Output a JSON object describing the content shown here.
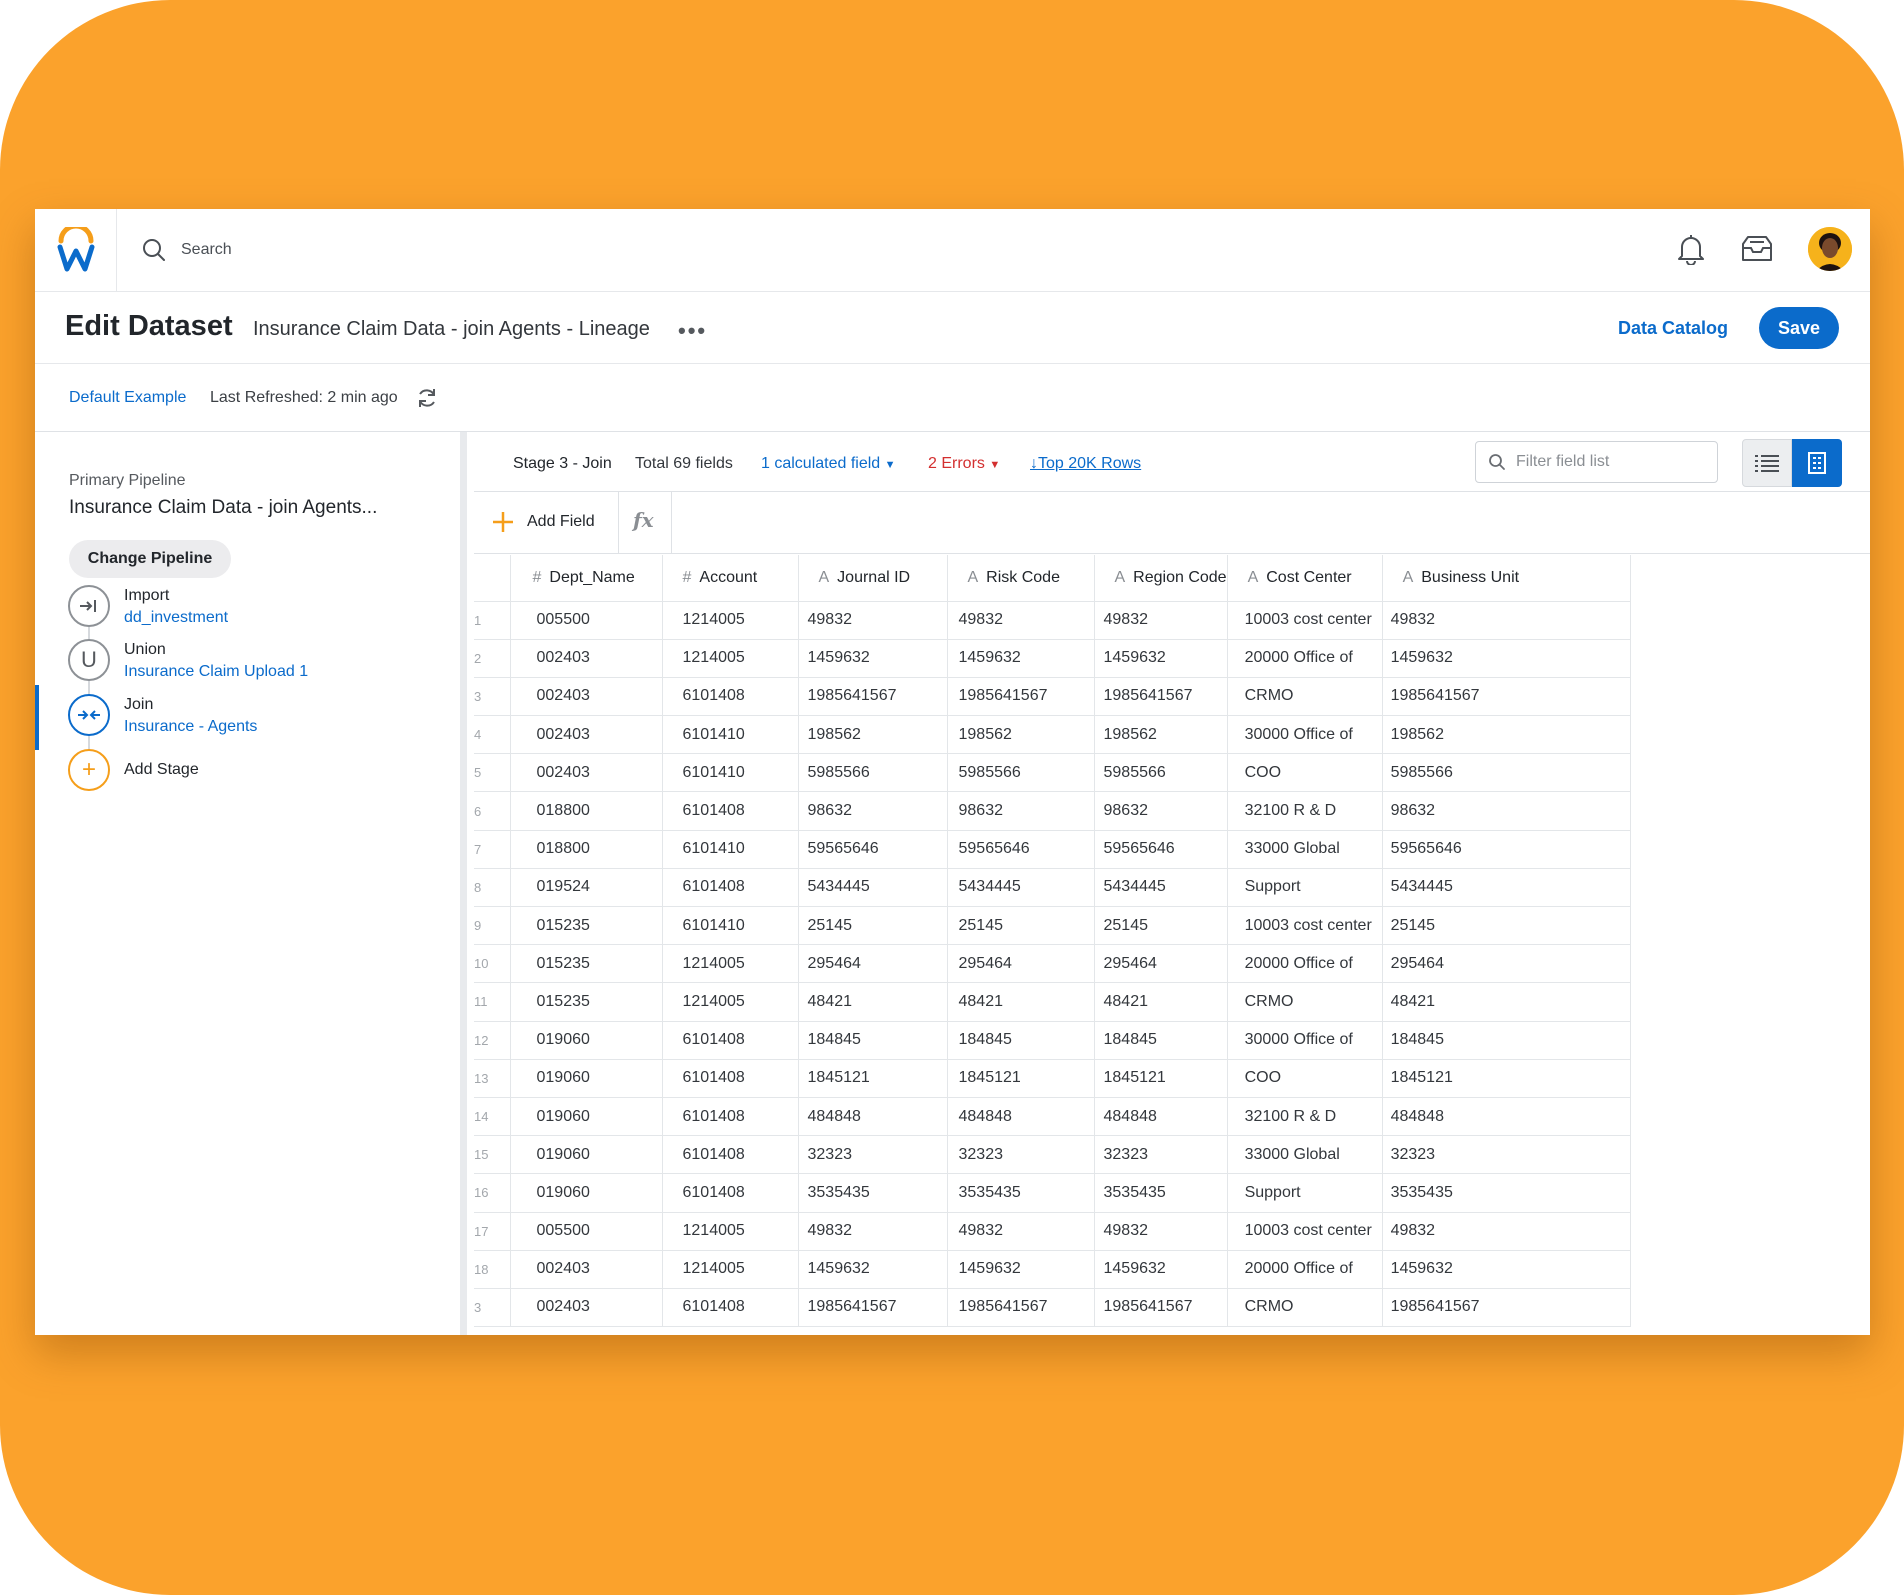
{
  "header": {
    "search_label": "Search"
  },
  "titlebar": {
    "title": "Edit Dataset",
    "subtitle": "Insurance Claim Data - join Agents - Lineage",
    "data_catalog": "Data Catalog",
    "save": "Save"
  },
  "subrow": {
    "default_example": "Default Example",
    "last_refreshed": "Last Refreshed: 2 min ago"
  },
  "pipeline": {
    "label": "Primary Pipeline",
    "name": "Insurance Claim Data - join Agents...",
    "change_button": "Change Pipeline",
    "stages": [
      {
        "name": "Import",
        "sub": "dd_investment"
      },
      {
        "name": "Union",
        "sub": "Insurance Claim Upload 1"
      },
      {
        "name": "Join",
        "sub": "Insurance - Agents"
      }
    ],
    "add_stage": "Add Stage"
  },
  "stagebar": {
    "stage": "Stage 3 - Join",
    "total_fields": "Total 69 fields",
    "calculated": "1 calculated field",
    "errors": "2 Errors",
    "top_rows": "Top 20K Rows",
    "filter_placeholder": "Filter field list"
  },
  "fieldbar": {
    "add_field": "Add Field",
    "fx": "fx"
  },
  "table": {
    "columns": [
      {
        "type": "#",
        "label": "Dept_Name"
      },
      {
        "type": "#",
        "label": "Account"
      },
      {
        "type": "A",
        "label": "Journal ID"
      },
      {
        "type": "A",
        "label": "Risk Code"
      },
      {
        "type": "A",
        "label": "Region Code"
      },
      {
        "type": "A",
        "label": "Cost Center"
      },
      {
        "type": "A",
        "label": "Business Unit"
      }
    ],
    "rows": [
      [
        "1",
        "005500",
        "1214005",
        "49832",
        "49832",
        "49832",
        "10003 cost center",
        "49832"
      ],
      [
        "2",
        "002403",
        "1214005",
        "1459632",
        "1459632",
        "1459632",
        "20000 Office of",
        "1459632"
      ],
      [
        "3",
        "002403",
        "6101408",
        "1985641567",
        "1985641567",
        "1985641567",
        "CRMO",
        "1985641567"
      ],
      [
        "4",
        "002403",
        "6101410",
        "198562",
        "198562",
        "198562",
        "30000 Office of",
        "198562"
      ],
      [
        "5",
        "002403",
        "6101410",
        "5985566",
        "5985566",
        "5985566",
        "COO",
        "5985566"
      ],
      [
        "6",
        "018800",
        "6101408",
        "98632",
        "98632",
        "98632",
        "32100 R & D",
        "98632"
      ],
      [
        "7",
        "018800",
        "6101410",
        "59565646",
        "59565646",
        "59565646",
        "33000 Global",
        "59565646"
      ],
      [
        "8",
        "019524",
        "6101408",
        "5434445",
        "5434445",
        "5434445",
        "Support",
        "5434445"
      ],
      [
        "9",
        "015235",
        "6101410",
        "25145",
        "25145",
        "25145",
        "10003 cost center",
        "25145"
      ],
      [
        "10",
        "015235",
        "1214005",
        "295464",
        "295464",
        "295464",
        "20000 Office of",
        "295464"
      ],
      [
        "11",
        "015235",
        "1214005",
        "48421",
        "48421",
        "48421",
        "CRMO",
        "48421"
      ],
      [
        "12",
        "019060",
        "6101408",
        "184845",
        "184845",
        "184845",
        "30000 Office of",
        "184845"
      ],
      [
        "13",
        "019060",
        "6101408",
        "1845121",
        "1845121",
        "1845121",
        "COO",
        "1845121"
      ],
      [
        "14",
        "019060",
        "6101408",
        "484848",
        "484848",
        "484848",
        "32100 R & D",
        "484848"
      ],
      [
        "15",
        "019060",
        "6101408",
        "32323",
        "32323",
        "32323",
        "33000 Global",
        "32323"
      ],
      [
        "16",
        "019060",
        "6101408",
        "3535435",
        "3535435",
        "3535435",
        "Support",
        "3535435"
      ],
      [
        "17",
        "005500",
        "1214005",
        "49832",
        "49832",
        "49832",
        "10003 cost center",
        "49832"
      ],
      [
        "18",
        "002403",
        "1214005",
        "1459632",
        "1459632",
        "1459632",
        "20000 Office of",
        "1459632"
      ],
      [
        "3",
        "002403",
        "6101408",
        "1985641567",
        "1985641567",
        "1985641567",
        "CRMO",
        "1985641567"
      ]
    ]
  },
  "colors": {
    "backdrop": "#FBA22C",
    "accent": "#0B6BCB",
    "error": "#D32F2F",
    "add": "#F59E1A"
  }
}
